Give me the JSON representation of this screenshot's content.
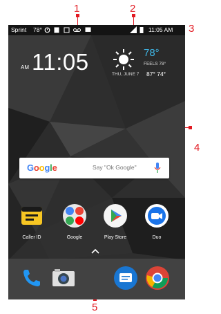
{
  "callouts": [
    "1",
    "2",
    "3",
    "4",
    "5"
  ],
  "status_bar": {
    "carrier": "Sprint",
    "temperature": "78°",
    "time": "11:05 AM"
  },
  "clock_widget": {
    "ampm": "AM",
    "time": "11:05"
  },
  "weather_widget": {
    "icon": "sun-icon",
    "temperature": "78°",
    "feels_like": "FEELS 78°",
    "date": "THU, JUNE 7",
    "high_low": "87° 74°"
  },
  "search_bar": {
    "logo": "Google",
    "hint": "Say \"Ok Google\""
  },
  "apps": [
    {
      "label": "Caller ID",
      "icon": "caller-id-icon"
    },
    {
      "label": "Google",
      "icon": "google-folder-icon"
    },
    {
      "label": "Play Store",
      "icon": "play-store-icon"
    },
    {
      "label": "Duo",
      "icon": "duo-icon"
    }
  ],
  "dock": [
    {
      "icon": "phone-icon"
    },
    {
      "icon": "camera-icon"
    },
    {
      "icon": "messages-icon"
    },
    {
      "icon": "chrome-icon"
    }
  ],
  "colors": {
    "callout": "#e21a22",
    "weather_accent": "#3fb6e6"
  }
}
